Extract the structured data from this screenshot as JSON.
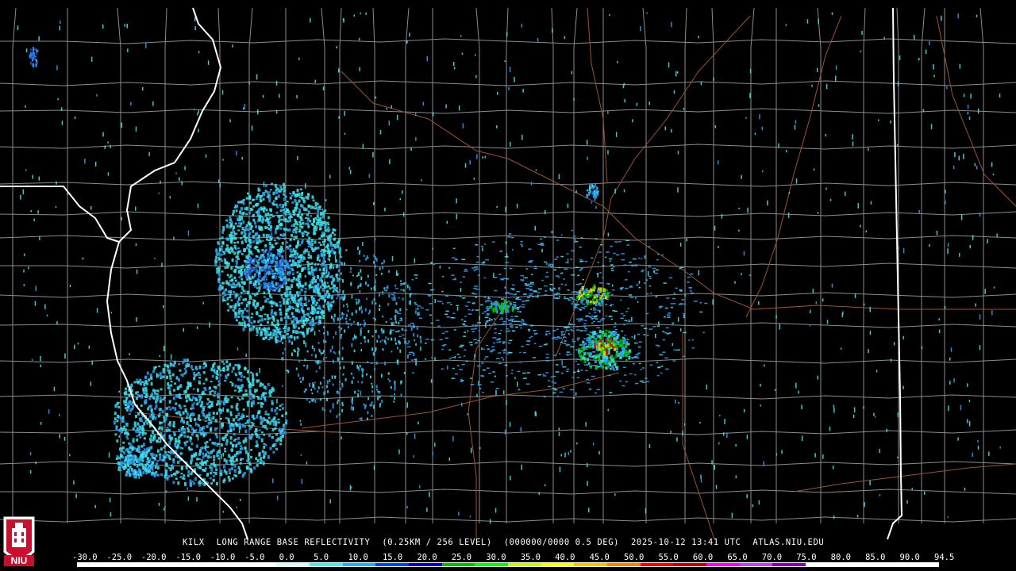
{
  "caption": {
    "site": "KILX",
    "product": "LONG RANGE BASE REFLECTIVITY",
    "resolution": "(0.25KM / 256 LEVEL)",
    "vcp": "(000000/0000 0.5 DEG)",
    "datetime": "2025-10-12 13:41 UTC",
    "source": "ATLAS.NIU.EDU"
  },
  "legend": {
    "ticks": [
      "-30.0",
      "-25.0",
      "-20.0",
      "-15.0",
      "-10.0",
      "-5.0",
      "0.0",
      "5.0",
      "10.0",
      "15.0",
      "20.0",
      "25.0",
      "30.0",
      "35.0",
      "40.0",
      "45.0",
      "50.0",
      "55.0",
      "60.0",
      "65.0",
      "70.0",
      "75.0",
      "80.0",
      "85.0",
      "90.0",
      "94.5"
    ],
    "colors": [
      "#ffffff",
      "#ffffff",
      "#ffffff",
      "#ffffff",
      "#ffffff",
      "#ffffff",
      "#d0ffff",
      "#40f0f0",
      "#20b0ff",
      "#0040ff",
      "#0000c0",
      "#00c000",
      "#00ff00",
      "#c0ff00",
      "#ffff00",
      "#ffc000",
      "#ff8000",
      "#ff0000",
      "#c00000",
      "#ff00ff",
      "#c040ff",
      "#8000c0",
      "#ffffff",
      "#ffffff",
      "#ffffff",
      "#ffffff"
    ]
  },
  "logo": {
    "text": "NIU",
    "color": "#c8102e"
  },
  "map": {
    "background": "#000000",
    "county_border_color": "#8c8c8c",
    "state_border_color": "#ffffff",
    "highway_color": "#a0522d",
    "echo_colors": {
      "light": "#40e0e8",
      "moderate": "#2a9df4",
      "heavy": "#2f4fd8",
      "green": "#00c800",
      "yellow": "#e0e000",
      "red": "#e00000"
    }
  }
}
